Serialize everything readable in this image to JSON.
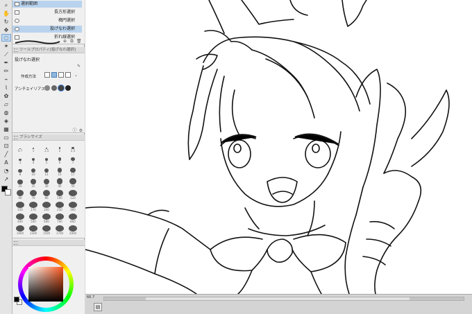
{
  "subtool_panel": {
    "items": [
      {
        "label": "選択範囲",
        "selected": false
      },
      {
        "label": "長方形選択",
        "selected": false
      },
      {
        "label": "楕円選択",
        "selected": false
      },
      {
        "label": "投げなわ選択",
        "selected": true
      },
      {
        "label": "折れ線選択",
        "selected": false
      }
    ]
  },
  "tool_property": {
    "header": "ツールプロパティ[投げなわ選択]",
    "tool_name": "投げなわ選択",
    "creation_method_label": "作成方法",
    "antialias_label": "アンチエイリアス"
  },
  "brush_size": {
    "header": "ブラシサイズ",
    "sizes": [
      "0.7",
      "1",
      "1.5",
      "2",
      "2.5",
      "3",
      "4",
      "5",
      "6",
      "7",
      "8",
      "10",
      "12",
      "15",
      "17",
      "20",
      "25",
      "30",
      "40",
      "50",
      "60",
      "70",
      "80",
      "100",
      "120",
      "150",
      "170",
      "200",
      "250",
      "300",
      "400",
      "500",
      "600",
      "700",
      "800",
      "1000",
      "1200",
      "1500",
      "1700",
      "2000"
    ]
  },
  "color": {
    "foreground": "#000000",
    "background": "#ffffff",
    "accent": "#b9d3ee"
  },
  "status": {
    "zoom": "66.7"
  }
}
